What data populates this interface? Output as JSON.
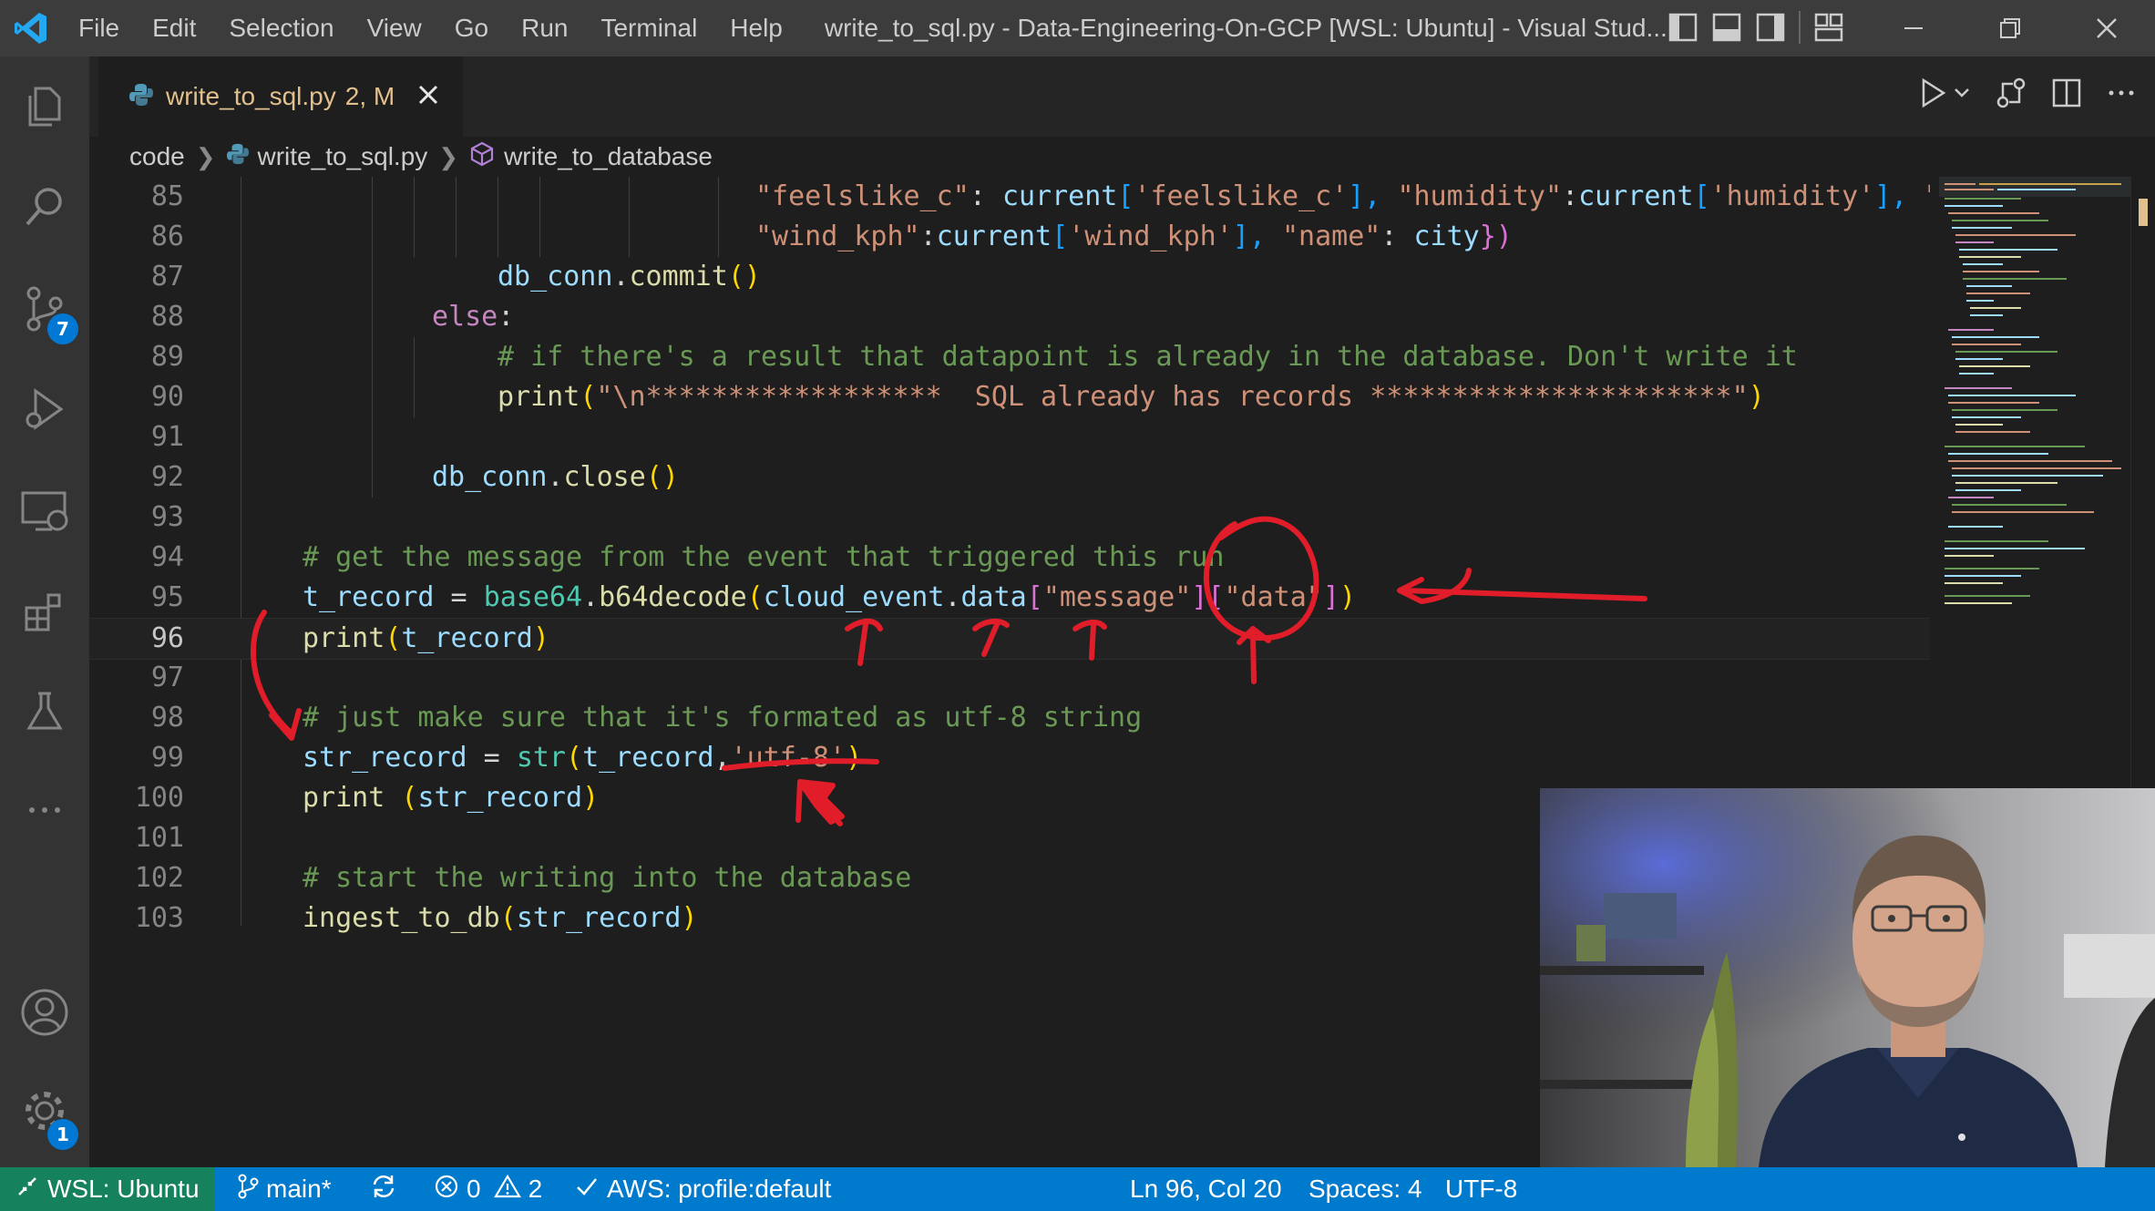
{
  "titlebar": {
    "menu": [
      "File",
      "Edit",
      "Selection",
      "View",
      "Go",
      "Run",
      "Terminal",
      "Help"
    ],
    "title": "write_to_sql.py - Data-Engineering-On-GCP [WSL: Ubuntu] - Visual Stud..."
  },
  "activitybar": {
    "source_control_badge": "7",
    "settings_badge": "1"
  },
  "tab": {
    "filename": "write_to_sql.py",
    "status": "2, M"
  },
  "breadcrumb": {
    "folder": "code",
    "file": "write_to_sql.py",
    "symbol": "write_to_database"
  },
  "editor": {
    "line_numbers": [
      "85",
      "86",
      "87",
      "88",
      "89",
      "90",
      "91",
      "92",
      "93",
      "94",
      "95",
      "96",
      "97",
      "98",
      "99",
      "100",
      "101",
      "102",
      "103"
    ],
    "current_line": "96",
    "code": {
      "l85": [
        "\"feelslike_c\"",
        ": ",
        "current",
        "[",
        "'feelslike_c'",
        "], ",
        "\"humidity\"",
        ":",
        "current",
        "[",
        "'humidity'",
        "], ",
        "\"l"
      ],
      "l86": [
        "\"wind_kph\"",
        ":",
        "current",
        "[",
        "'wind_kph'",
        "], ",
        "\"name\"",
        ": ",
        "city",
        "})"
      ],
      "l87": [
        "db_conn",
        ".",
        "commit",
        "()"
      ],
      "l88": [
        "else",
        ":"
      ],
      "l89": "# if there's a result that datapoint is already in the database. Don't write it",
      "l90": [
        "print",
        "(",
        "\"\\n******************  SQL already has records **********************\"",
        ")"
      ],
      "l92": [
        "db_conn",
        ".",
        "close",
        "()"
      ],
      "l94": "# get the message from the event that triggered this run",
      "l95": [
        "t_record",
        " = ",
        "base64",
        ".",
        "b64decode",
        "(",
        "cloud_event",
        ".",
        "data",
        "[",
        "\"message\"",
        "][",
        "\"data\"",
        "]",
        ")"
      ],
      "l96": [
        "print",
        "(",
        "t_record",
        ")"
      ],
      "l98": "# just make sure that it's formated as utf-8 string",
      "l99": [
        "str_record",
        " = ",
        "str",
        "(",
        "t_record",
        ",",
        "'utf-8'",
        ")"
      ],
      "l100": [
        "print",
        " (",
        "str_record",
        ")"
      ],
      "l102": "# start the writing into the database",
      "l103": [
        "ingest_to_db",
        "(",
        "str_record",
        ")"
      ]
    }
  },
  "statusbar": {
    "remote": "WSL: Ubuntu",
    "branch": "main*",
    "errors": "0",
    "warnings": "2",
    "aws": "AWS: profile:default",
    "position": "Ln 96, Col 20",
    "spaces": "Spaces: 4",
    "encoding": "UTF-8"
  },
  "colors": {
    "statusbar": "#007acc",
    "remote": "#16825d",
    "annotation": "#e11d2a"
  }
}
